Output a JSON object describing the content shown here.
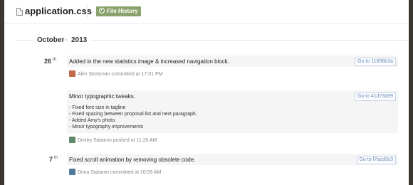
{
  "header": {
    "file_name": "application.css",
    "history_button": "File History"
  },
  "timeline": {
    "month": "October",
    "year": "2013"
  },
  "days": [
    {
      "day": "26",
      "suffix": "th"
    },
    {
      "day": "7",
      "suffix": "th"
    }
  ],
  "commits": [
    {
      "title": "Added in the new statistics image & increased navigation block.",
      "goto": "Go to 11836b3a",
      "author": "Alex Strasman committed at 17:01 PM",
      "avatar_color": "#c06a4a"
    },
    {
      "title": "Minor typographic tweaks.",
      "goto": "Go to 41d73a99",
      "details": [
        "- Fixed font size in tagline",
        "- Fixed spacing between proposal list and next paragraph.",
        "- Added Amy's photo.",
        "- Minor typography improvements"
      ],
      "author": "Dmitry Sabanin pushed at 11:20 AM",
      "avatar_color": "#5f8a6a"
    },
    {
      "title": "Fixed scroll animation by removing obsolete code.",
      "goto": "Go to f7acd9c3",
      "author": "Dima Sabanin committed at 10:59 AM",
      "avatar_color": "#4f7a9a"
    }
  ]
}
